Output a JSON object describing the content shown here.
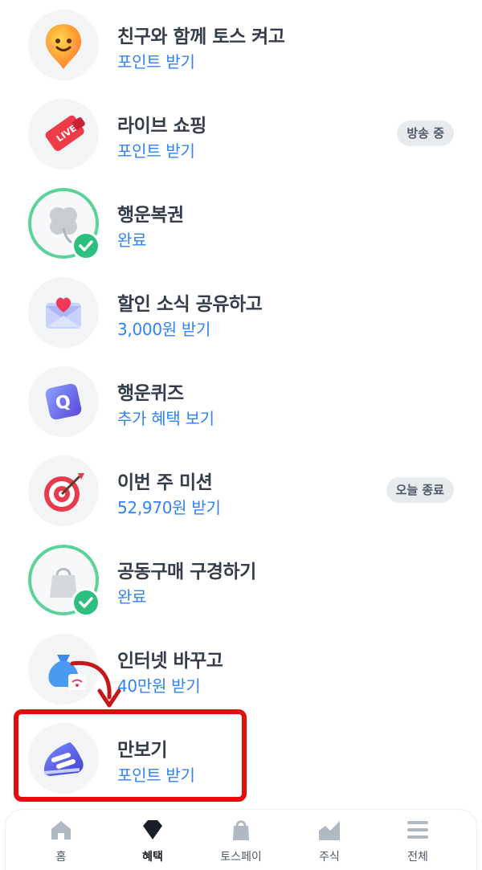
{
  "benefits": [
    {
      "title": "친구와 함께 토스 켜고",
      "subtitle": "포인트 받기",
      "icon": "smile-pin-icon"
    },
    {
      "title": "라이브 쇼핑",
      "subtitle": "포인트 받기",
      "badge": "방송 중",
      "icon": "live-tag-icon"
    },
    {
      "title": "행운복권",
      "subtitle": "완료",
      "icon": "clover-icon",
      "completed": true
    },
    {
      "title": "할인 소식 공유하고",
      "subtitle": "3,000원 받기",
      "icon": "heart-envelope-icon"
    },
    {
      "title": "행운퀴즈",
      "subtitle": "추가 혜택 보기",
      "icon": "quiz-q-icon"
    },
    {
      "title": "이번 주 미션",
      "subtitle": "52,970원 받기",
      "badge": "오늘 종료",
      "icon": "target-dart-icon"
    },
    {
      "title": "공동구매 구경하기",
      "subtitle": "완료",
      "icon": "shopping-bag-icon",
      "completed": true
    },
    {
      "title": "인터넷 바꾸고",
      "subtitle": "40만원 받기",
      "icon": "money-bag-wifi-icon"
    },
    {
      "title": "만보기",
      "subtitle": "포인트 받기",
      "icon": "sneaker-icon",
      "highlighted": true
    }
  ],
  "nav": {
    "items": [
      {
        "label": "홈",
        "icon": "home-icon"
      },
      {
        "label": "혜택",
        "icon": "diamond-icon",
        "active": true
      },
      {
        "label": "토스페이",
        "icon": "shopping-bag-icon"
      },
      {
        "label": "주식",
        "icon": "chart-icon"
      },
      {
        "label": "전체",
        "icon": "menu-icon"
      }
    ]
  },
  "colors": {
    "title": "#333d4b",
    "subtitle": "#3182f6",
    "completed_ring": "#5bd29a",
    "check": "#2dbf7d",
    "highlight": "#e30d0d",
    "arrow": "#c4181b"
  }
}
